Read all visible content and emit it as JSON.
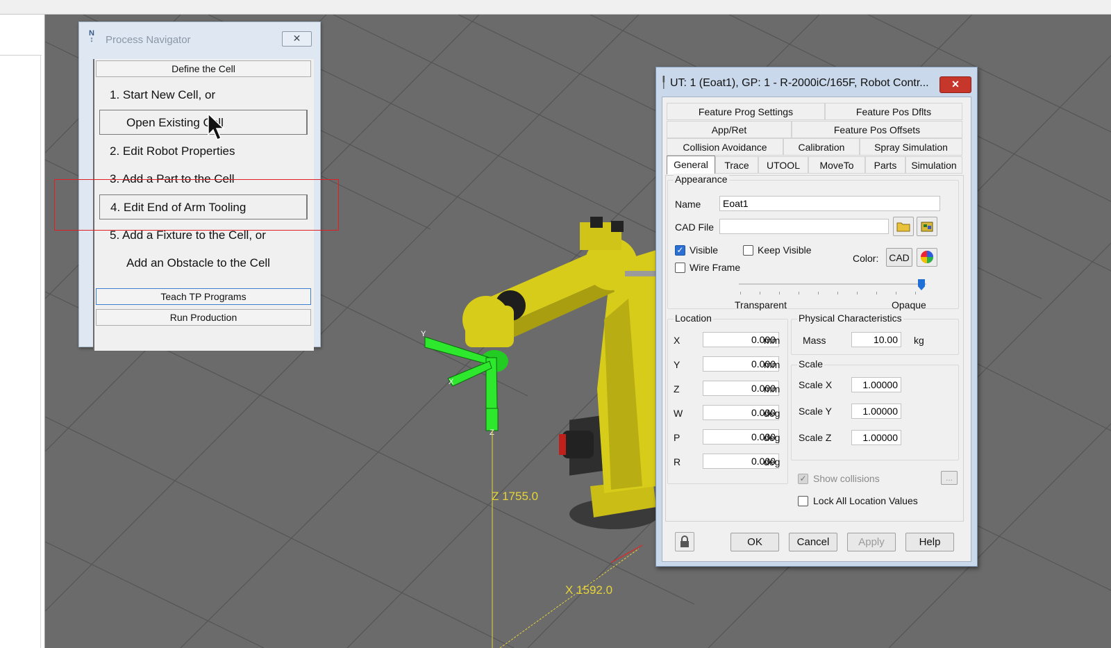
{
  "process_navigator": {
    "title": "Process Navigator",
    "close_glyph": "✕",
    "title_icon": "navigator-icon",
    "define_cell": "Define the Cell",
    "steps": [
      "1.  Start New Cell, or",
      "Open Existing Cell",
      "2.  Edit Robot Properties",
      "3.  Add a Part to the Cell",
      "4.  Edit End of Arm Tooling",
      "5.  Add a Fixture to the Cell, or",
      "Add an Obstacle to the Cell"
    ],
    "teach_tp": "Teach TP Programs",
    "run_production": "Run Production"
  },
  "viewport": {
    "z_label": "Z 1755.0",
    "x_label": "X 1592.0",
    "tool_axis_labels": [
      "Y",
      "X",
      "Z"
    ],
    "grid_color": "#5a5a5a",
    "background_color": "#6b6b6b",
    "robot_color": "#d8cc1a",
    "tool_color": "#22dd22"
  },
  "dialog": {
    "title": "UT: 1  (Eoat1), GP: 1 - R-2000iC/165F, Robot Contr...",
    "close_glyph": "✕",
    "tabs_row1": [
      "Feature Prog Settings",
      "Feature Pos Dflts"
    ],
    "tabs_row2": [
      "App/Ret",
      "Feature Pos Offsets"
    ],
    "tabs_row3": [
      "Collision Avoidance",
      "Calibration",
      "Spray Simulation"
    ],
    "tabs_row4": [
      "General",
      "Trace",
      "UTOOL",
      "MoveTo",
      "Parts",
      "Simulation"
    ],
    "appearance": {
      "group_label": "Appearance",
      "name_label": "Name",
      "name_value": "Eoat1",
      "cad_label": "CAD File",
      "cad_value": "",
      "visible_label": "Visible",
      "visible_checked": true,
      "keep_visible_label": "Keep Visible",
      "keep_visible_checked": false,
      "wireframe_label": "Wire Frame",
      "wireframe_checked": false,
      "color_label": "Color:",
      "cad_button": "CAD",
      "transparent_label": "Transparent",
      "opaque_label": "Opaque",
      "opacity": 1.0
    },
    "location": {
      "group_label": "Location",
      "rows": [
        {
          "axis": "X",
          "value": "0.000",
          "unit": "mm"
        },
        {
          "axis": "Y",
          "value": "0.000",
          "unit": "mm"
        },
        {
          "axis": "Z",
          "value": "0.000",
          "unit": "mm"
        },
        {
          "axis": "W",
          "value": "0.000",
          "unit": "deg"
        },
        {
          "axis": "P",
          "value": "0.000",
          "unit": "deg"
        },
        {
          "axis": "R",
          "value": "0.000",
          "unit": "deg"
        }
      ]
    },
    "physical": {
      "group_label": "Physical Characteristics",
      "mass_label": "Mass",
      "mass_value": "10.00",
      "mass_unit": "kg"
    },
    "scale": {
      "group_label": "Scale",
      "rows": [
        {
          "label": "Scale X",
          "value": "1.00000"
        },
        {
          "label": "Scale Y",
          "value": "1.00000"
        },
        {
          "label": "Scale Z",
          "value": "1.00000"
        }
      ]
    },
    "show_collisions_label": "Show collisions",
    "ellipsis_button": "...",
    "lock_all_label": "Lock All Location Values",
    "buttons": {
      "ok": "OK",
      "cancel": "Cancel",
      "apply": "Apply",
      "help": "Help"
    }
  }
}
